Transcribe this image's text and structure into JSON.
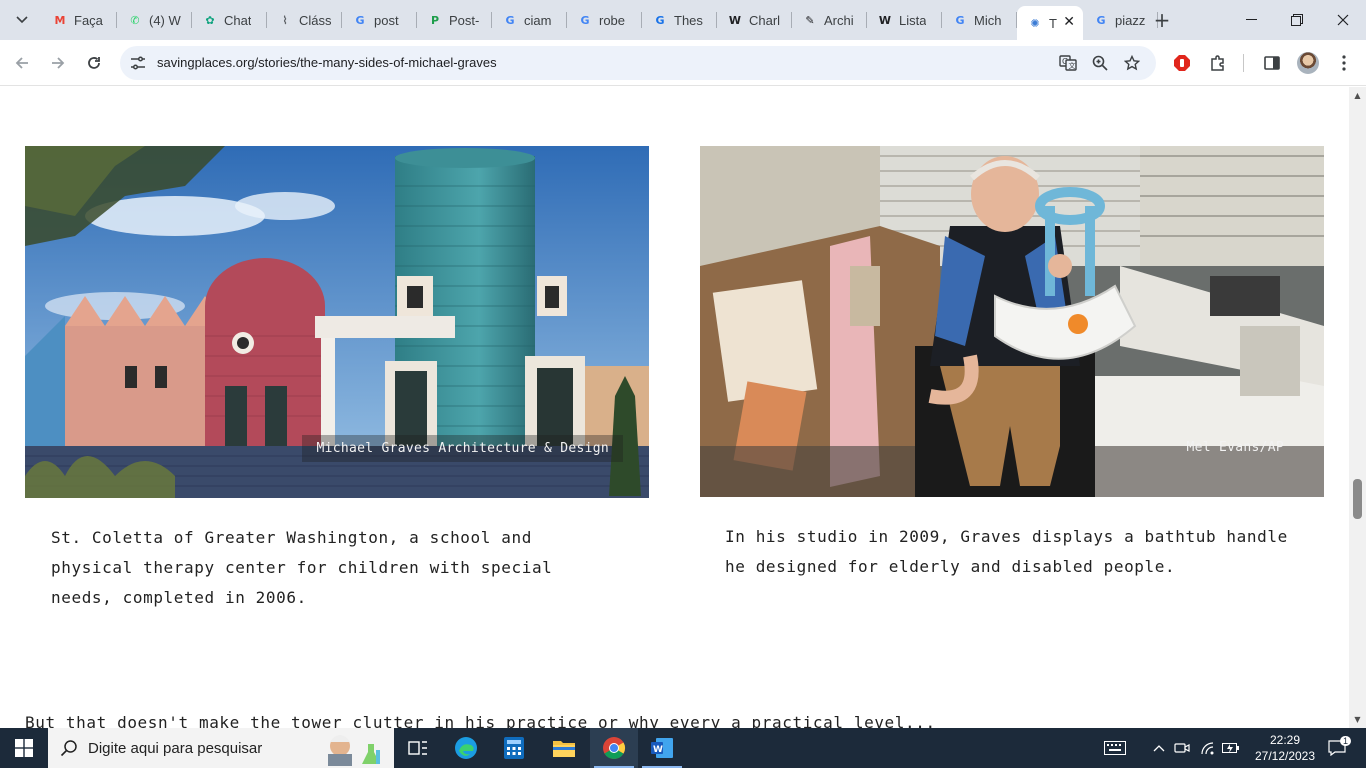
{
  "browser": {
    "tabs": [
      {
        "label": "Faça",
        "icon": "gmail-icon",
        "color": "#ea4335"
      },
      {
        "label": "(4) W",
        "icon": "whatsapp-icon",
        "color": "#25d366"
      },
      {
        "label": "Chat",
        "icon": "chatgpt-icon",
        "color": "#10a37f"
      },
      {
        "label": "Cláss",
        "icon": "clip-icon",
        "color": "#5f6368"
      },
      {
        "label": "post",
        "icon": "google-icon",
        "color": "#4285f4"
      },
      {
        "label": "Post-",
        "icon": "p-icon",
        "color": "#1e9e4b"
      },
      {
        "label": "ciam",
        "icon": "google-icon",
        "color": "#4285f4"
      },
      {
        "label": "robe",
        "icon": "google-icon",
        "color": "#4285f4"
      },
      {
        "label": "Thes",
        "icon": "g-site-icon",
        "color": "#1a73e8"
      },
      {
        "label": "Charl",
        "icon": "wikipedia-icon",
        "color": "#202124"
      },
      {
        "label": "Archi",
        "icon": "archi-icon",
        "color": "#202124"
      },
      {
        "label": "Lista",
        "icon": "wikipedia-icon",
        "color": "#202124"
      },
      {
        "label": "Mich",
        "icon": "google-icon",
        "color": "#4285f4"
      },
      {
        "label": "T",
        "icon": "savingplaces-icon",
        "color": "#3a7bd5"
      },
      {
        "label": "piazz",
        "icon": "google-icon",
        "color": "#4285f4"
      }
    ],
    "address": "savingplaces.org/stories/the-many-sides-of-michael-graves"
  },
  "page": {
    "figures": [
      {
        "credit": "Michael Graves Architecture & Design",
        "caption": "St. Coletta of Greater Washington, a school and physical therapy center for children with special needs, completed in 2006."
      },
      {
        "credit": "Mel Evans/AP",
        "caption": "In his studio in 2009, Graves displays a bathtub handle he designed for elderly and disabled people."
      }
    ],
    "cut_text": "But that doesn't make the tower clutter in his practice or why every a practical level..."
  },
  "taskbar": {
    "search_placeholder": "Digite aqui para pesquisar",
    "time": "22:29",
    "date": "27/12/2023",
    "notification_count": "1"
  },
  "colors": {
    "tabstrip": "#dee3eb",
    "omnibox": "#edf2fa",
    "taskbar": "#1c2a3a"
  }
}
